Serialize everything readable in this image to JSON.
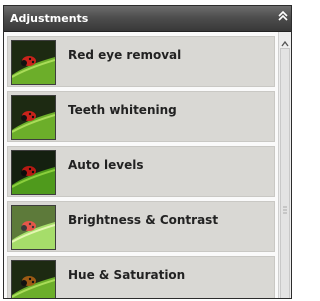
{
  "panel": {
    "title": "Adjustments",
    "collapse_icon": "double-chevron-up-icon"
  },
  "items": [
    {
      "label": "Red eye removal",
      "thumbnail": "ladybug-thumbnail"
    },
    {
      "label": "Teeth whitening",
      "thumbnail": "ladybug-thumbnail"
    },
    {
      "label": "Auto levels",
      "thumbnail": "ladybug-thumbnail"
    },
    {
      "label": "Brightness & Contrast",
      "thumbnail": "ladybug-thumbnail"
    },
    {
      "label": "Hue & Saturation",
      "thumbnail": "ladybug-thumbnail"
    }
  ],
  "colors": {
    "header": "#4e4e4e",
    "item_background": "#d9d8d4",
    "ladybug": "#c8231b",
    "leaf": "#6cae2a"
  }
}
